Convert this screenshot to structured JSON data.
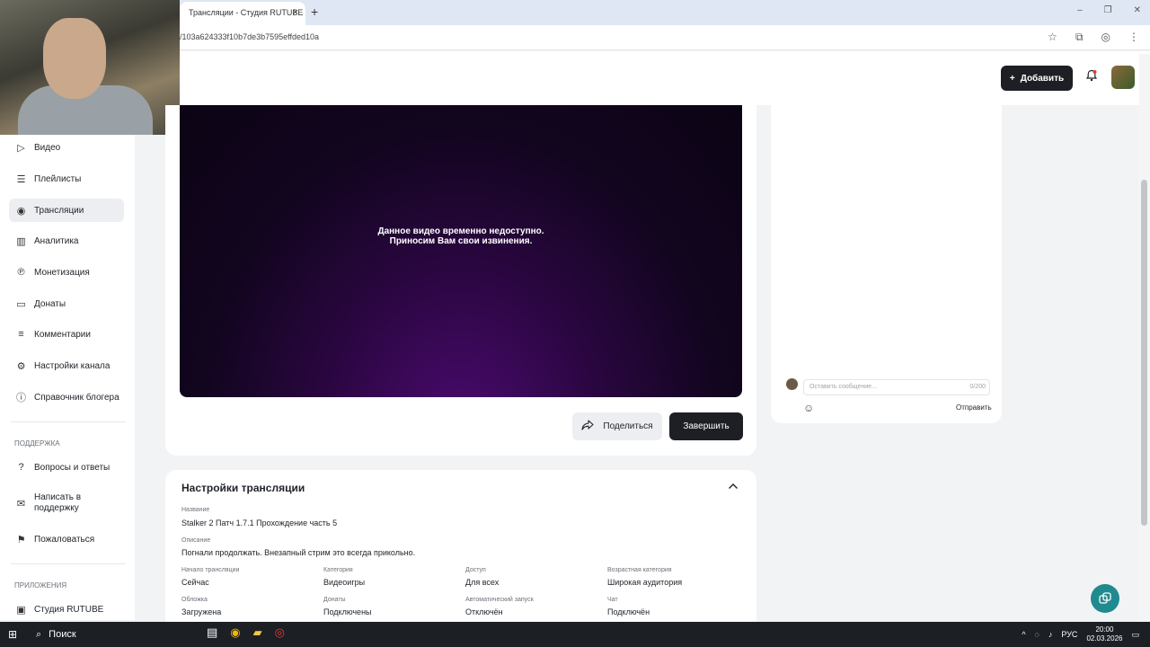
{
  "browser": {
    "tab_title": "Трансляции - Студия RUTUBE",
    "tab_close": "×",
    "new_tab": "+",
    "url": "/103a624333f10b7de3b7595effded10a",
    "window_controls": [
      "–",
      "❐",
      "✕"
    ]
  },
  "header": {
    "add_label": "Добавить"
  },
  "sidebar": {
    "items": [
      {
        "label": "Видео",
        "icon": "video-icon"
      },
      {
        "label": "Плейлисты",
        "icon": "playlist-icon"
      },
      {
        "label": "Трансляции",
        "icon": "broadcast-icon",
        "active": true
      },
      {
        "label": "Аналитика",
        "icon": "chart-icon"
      },
      {
        "label": "Монетизация",
        "icon": "coin-icon"
      },
      {
        "label": "Донаты",
        "icon": "donate-icon"
      },
      {
        "label": "Комментарии",
        "icon": "comment-icon"
      },
      {
        "label": "Настройки канала",
        "icon": "gear-icon"
      },
      {
        "label": "Справочник блогера",
        "icon": "info-icon"
      }
    ],
    "support_heading": "ПОДДЕРЖКА",
    "support_items": [
      {
        "label": "Вопросы и ответы",
        "icon": "question-icon"
      },
      {
        "label": "Написать в поддержку",
        "icon": "mail-icon"
      },
      {
        "label": "Пожаловаться",
        "icon": "flag-icon"
      }
    ],
    "apps_heading": "ПРИЛОЖЕНИЯ",
    "apps_items": [
      {
        "label": "Студия RUTUBE",
        "icon": "studio-icon"
      }
    ]
  },
  "player": {
    "message_line1": "Данное видео временно недоступно.",
    "message_line2": "Приносим Вам свои извинения."
  },
  "actions": {
    "share_label": "Поделиться",
    "finish_label": "Завершить"
  },
  "chat": {
    "placeholder": "Оставить сообщение...",
    "counter": "0/200",
    "send_label": "Отправить"
  },
  "settings": {
    "title": "Настройки трансляции",
    "name_label": "Название",
    "name_value": "Stalker 2 Патч 1.7.1 Прохождение часть 5",
    "desc_label": "Описание",
    "desc_value": "Погнали продолжать. Внезапный стрим это всегда прикольно.",
    "fields_row1": [
      {
        "label": "Начало трансляции",
        "value": "Сейчас"
      },
      {
        "label": "Категория",
        "value": "Видеоигры"
      },
      {
        "label": "Доступ",
        "value": "Для всех"
      },
      {
        "label": "Возрастная категория",
        "value": "Широкая аудитория"
      }
    ],
    "fields_row2": [
      {
        "label": "Обложка",
        "value": "Загружена"
      },
      {
        "label": "Донаты",
        "value": "Подключены"
      },
      {
        "label": "Автоматический запуск",
        "value": "Отключён"
      },
      {
        "label": "Чат",
        "value": "Подключён"
      }
    ]
  },
  "taskbar": {
    "search_label": "Поиск",
    "lang": "РУС",
    "time": "20:00",
    "date": "02.03.2026"
  },
  "colors": {
    "accent_dark": "#1e1f24",
    "support_teal": "#1f8a8f",
    "player_purple": "#4a0a6e"
  }
}
